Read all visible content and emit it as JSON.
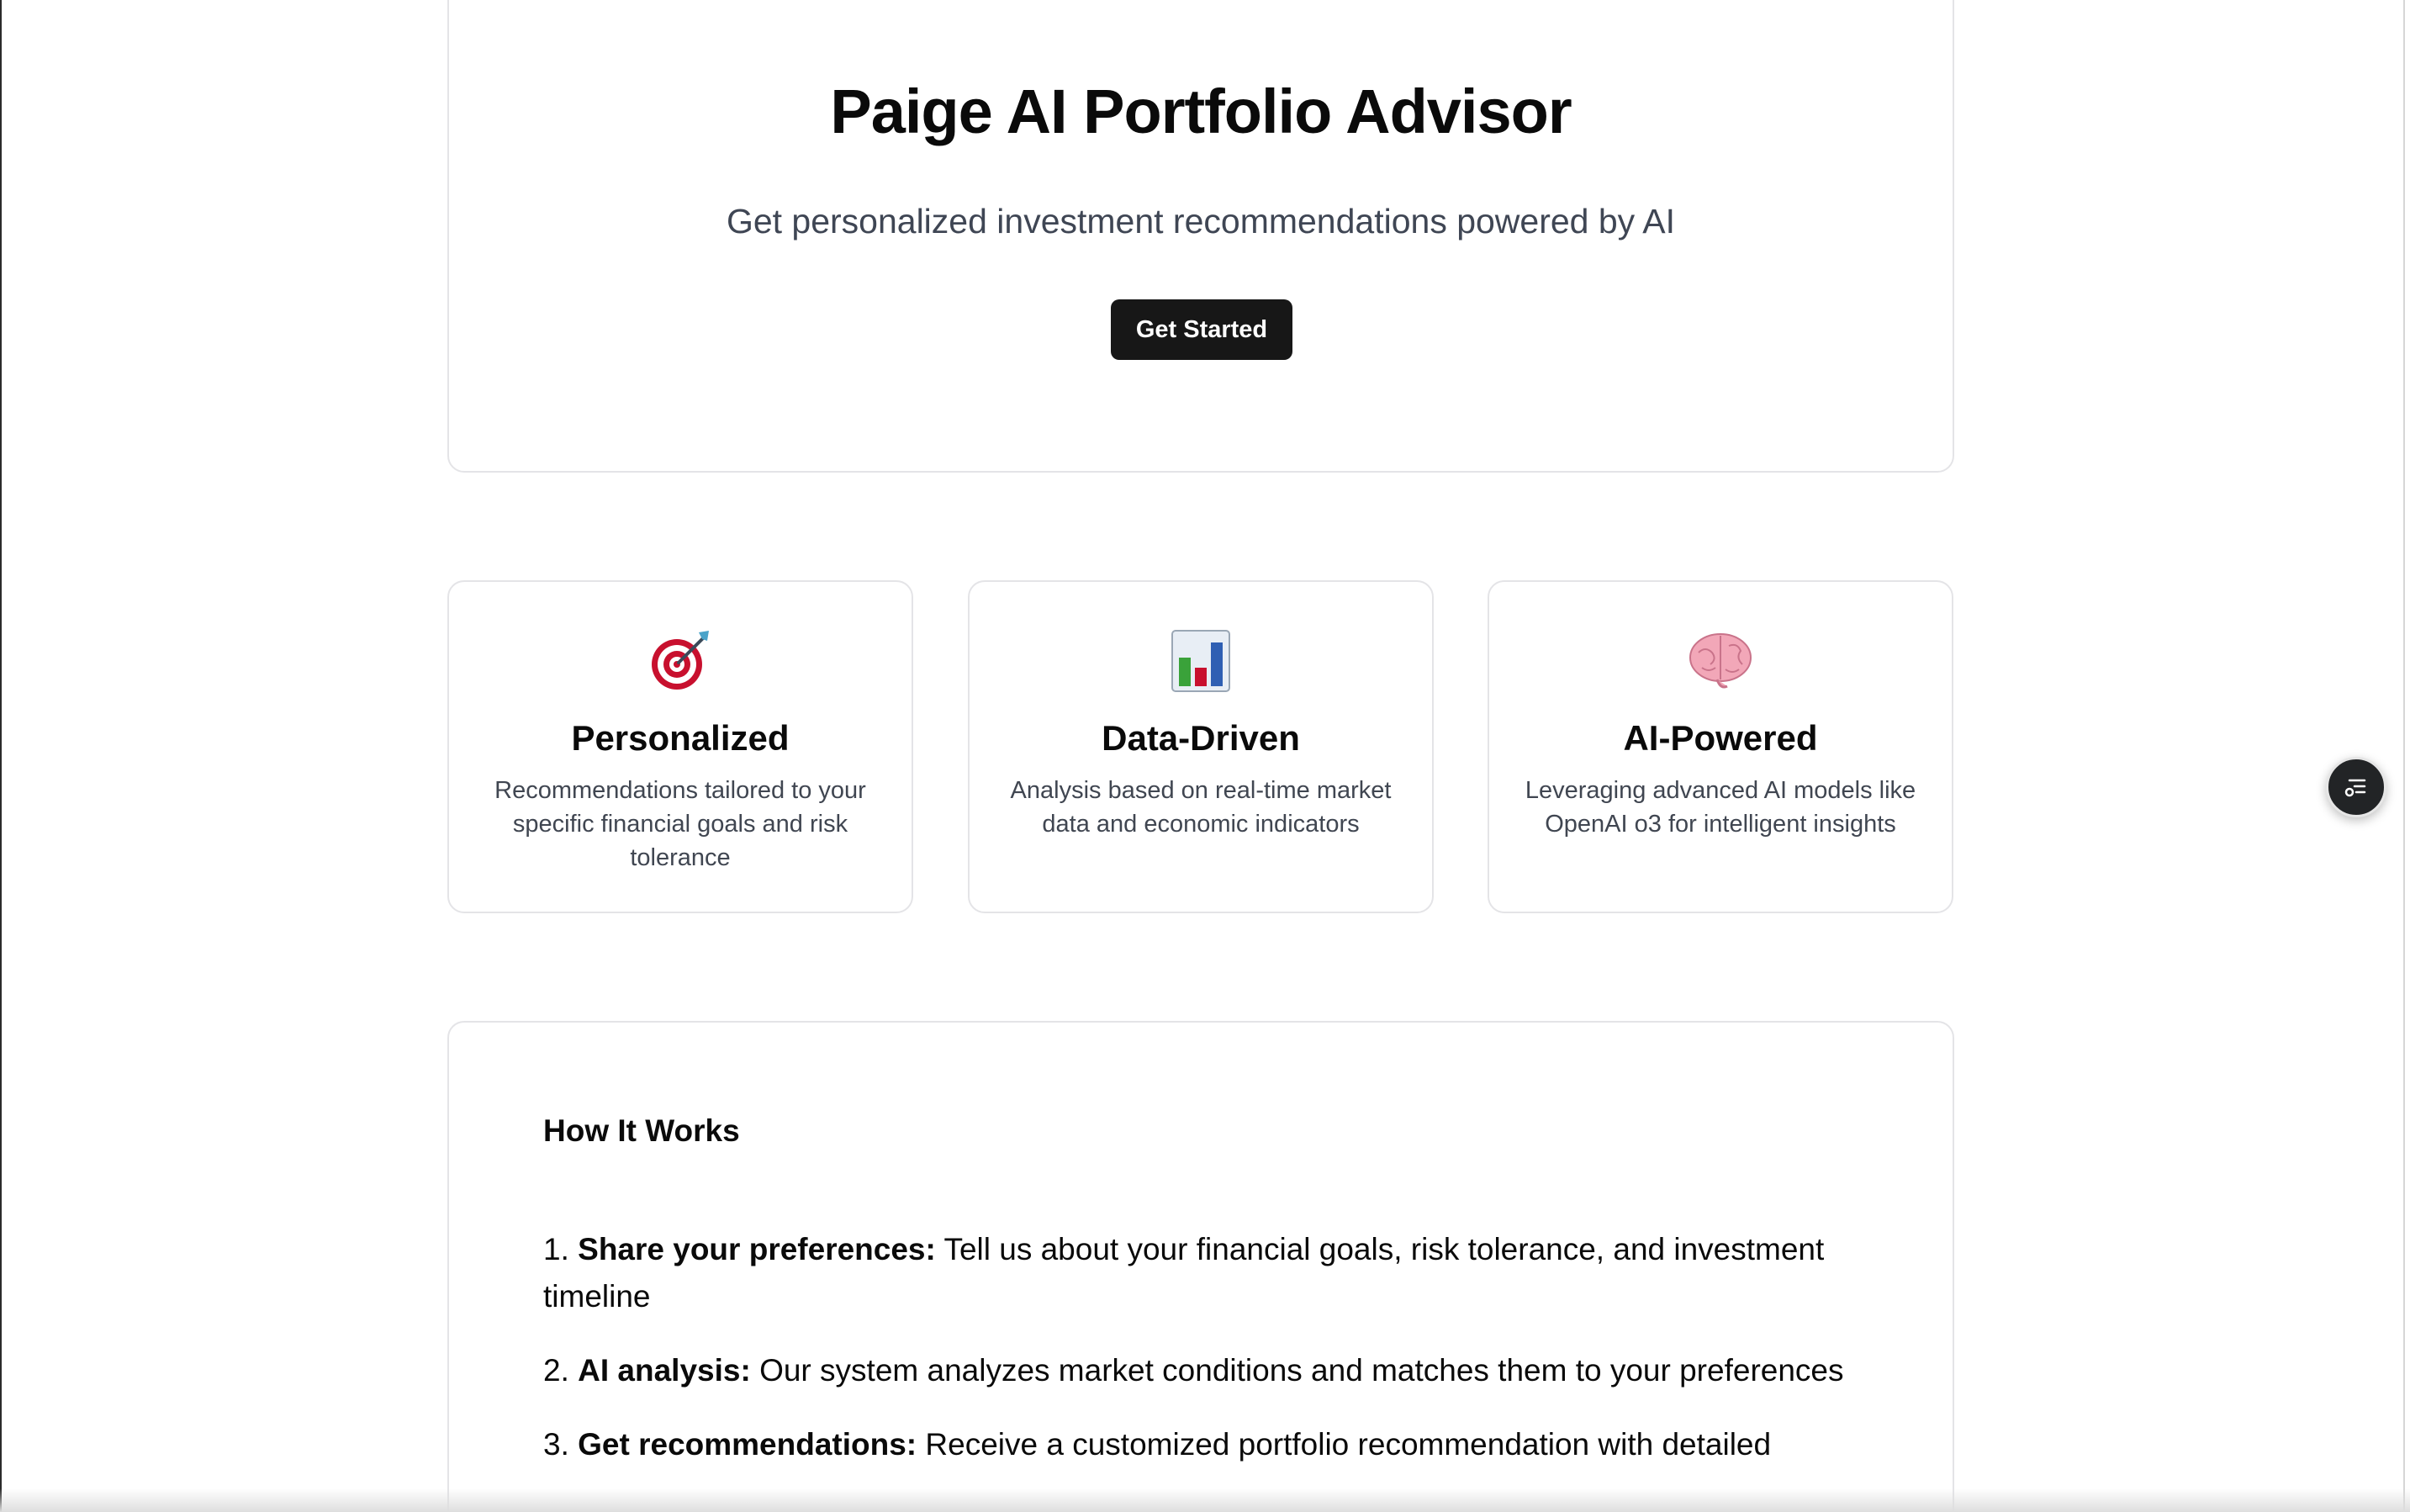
{
  "hero": {
    "title": "Paige AI Portfolio Advisor",
    "subtitle": "Get personalized investment recommendations powered by AI",
    "cta_label": "Get Started"
  },
  "features": [
    {
      "icon": "target-icon",
      "title": "Personalized",
      "description": "Recommendations tailored to your specific financial goals and risk tolerance"
    },
    {
      "icon": "bar-chart-icon",
      "title": "Data-Driven",
      "description": "Analysis based on real-time market data and economic indicators"
    },
    {
      "icon": "brain-icon",
      "title": "AI-Powered",
      "description": "Leveraging advanced AI models like OpenAI o3 for intelligent insights"
    }
  ],
  "how_it_works": {
    "title": "How It Works",
    "steps": [
      {
        "number": "1.",
        "heading": "Share your preferences:",
        "text": "Tell us about your financial goals, risk tolerance, and investment timeline"
      },
      {
        "number": "2.",
        "heading": "AI analysis:",
        "text": "Our system analyzes market conditions and matches them to your preferences"
      },
      {
        "number": "3.",
        "heading": "Get recommendations:",
        "text": "Receive a customized portfolio recommendation with detailed"
      }
    ]
  },
  "floating_button": {
    "icon": "list-settings-icon"
  },
  "colors": {
    "primary": "#171717",
    "border": "#e4e4e7",
    "muted_text": "#404651"
  }
}
